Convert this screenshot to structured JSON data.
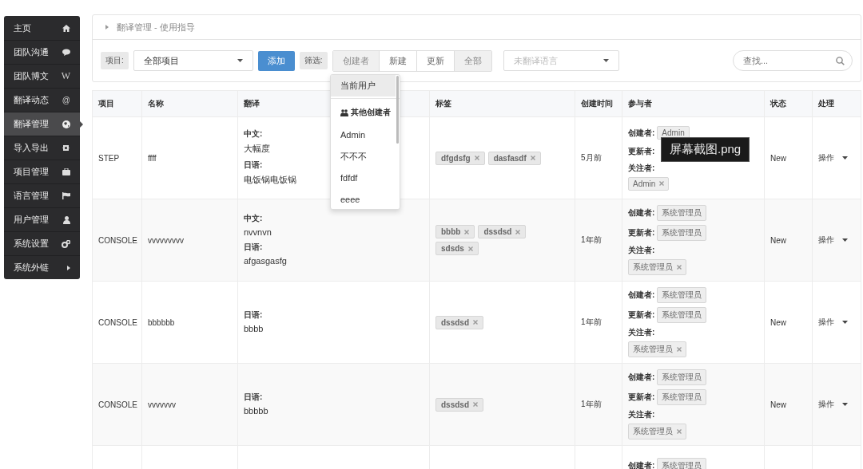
{
  "sidebar": {
    "items": [
      {
        "label": "主页",
        "selected": false
      },
      {
        "label": "团队沟通",
        "selected": false
      },
      {
        "label": "团队博文",
        "glyph": "W",
        "selected": false
      },
      {
        "label": "翻译动态",
        "glyph": "@",
        "selected": false
      },
      {
        "label": "翻译管理",
        "selected": true
      },
      {
        "label": "导入导出",
        "selected": false
      },
      {
        "label": "项目管理",
        "selected": false
      },
      {
        "label": "语言管理",
        "selected": false
      },
      {
        "label": "用户管理",
        "selected": false
      },
      {
        "label": "系统设置",
        "selected": false
      },
      {
        "label": "系统外链",
        "selected": false
      }
    ]
  },
  "breadcrumb": "翻译管理 - 使用指导",
  "toolbar": {
    "project_label": "项目:",
    "project_select": "全部项目",
    "add_button": "添加",
    "filter_label": "筛选:",
    "filters": [
      {
        "label": "创建者",
        "selected": true
      },
      {
        "label": "新建",
        "selected": false
      },
      {
        "label": "更新",
        "selected": false
      },
      {
        "label": "全部",
        "selected": true
      }
    ],
    "language_select": {
      "placeholder": "未翻译语言"
    },
    "search": {
      "placeholder": "查找..."
    }
  },
  "creator_menu": {
    "items": [
      {
        "kind": "option",
        "label": "当前用户",
        "selected": true
      },
      {
        "kind": "divider"
      },
      {
        "kind": "header",
        "label": "其他创建者"
      },
      {
        "kind": "option",
        "label": "Admin",
        "selected": false
      },
      {
        "kind": "option",
        "label": "不不不",
        "selected": false
      },
      {
        "kind": "option",
        "label": "fdfdf",
        "selected": false
      },
      {
        "kind": "option",
        "label": "eeee",
        "selected": false
      }
    ]
  },
  "table": {
    "columns": [
      "项目",
      "名称",
      "翻译",
      "标签",
      "创建时间",
      "参与者",
      "状态",
      "处理"
    ],
    "rows": [
      {
        "project": "STEP",
        "name": "ffff",
        "translations": [
          {
            "lang": "中文:",
            "text": "大幅度"
          },
          {
            "lang": "日语:",
            "text": "电饭锅电饭锅"
          }
        ],
        "tags": [
          "dfgdsfg",
          "dasfasdf"
        ],
        "created": "5月前",
        "participants": [
          {
            "kind": "inline",
            "label": "创建者:",
            "tags": [
              {
                "text": "Admin",
                "removable": false
              }
            ]
          },
          {
            "kind": "inline",
            "label": "更新者:"
          },
          {
            "kind": "stacked",
            "label": "关注者:",
            "tags": [
              {
                "text": "Admin",
                "removable": true
              }
            ]
          }
        ],
        "status": "New",
        "action": "操作"
      },
      {
        "project": "CONSOLE",
        "name": "vvvvvvvvv",
        "translations": [
          {
            "lang": "中文:",
            "text": "nvvnvn"
          },
          {
            "lang": "日语:",
            "text": "afgasgasfg"
          }
        ],
        "tags": [
          "bbbb",
          "dssdsd",
          "sdsds"
        ],
        "created": "1年前",
        "participants": [
          {
            "kind": "inline",
            "label": "创建者:",
            "tags": [
              {
                "text": "系统管理员",
                "removable": false
              }
            ]
          },
          {
            "kind": "inline",
            "label": "更新者:",
            "tags": [
              {
                "text": "系统管理员",
                "removable": false
              }
            ]
          },
          {
            "kind": "stacked",
            "label": "关注者:",
            "tags": [
              {
                "text": "系统管理员",
                "removable": true
              }
            ]
          }
        ],
        "status": "New",
        "action": "操作"
      },
      {
        "project": "CONSOLE",
        "name": "bbbbbb",
        "translations": [
          {
            "lang": "日语:",
            "text": "bbbb"
          }
        ],
        "tags": [
          "dssdsd"
        ],
        "created": "1年前",
        "participants": [
          {
            "kind": "inline",
            "label": "创建者:",
            "tags": [
              {
                "text": "系统管理员",
                "removable": false
              }
            ]
          },
          {
            "kind": "inline",
            "label": "更新者:",
            "tags": [
              {
                "text": "系统管理员",
                "removable": false
              }
            ]
          },
          {
            "kind": "stacked",
            "label": "关注者:",
            "tags": [
              {
                "text": "系统管理员",
                "removable": true
              }
            ]
          }
        ],
        "status": "New",
        "action": "操作"
      },
      {
        "project": "CONSOLE",
        "name": "vvvvvvv",
        "translations": [
          {
            "lang": "日语:",
            "text": "bbbbb"
          }
        ],
        "tags": [
          "dssdsd"
        ],
        "created": "1年前",
        "participants": [
          {
            "kind": "inline",
            "label": "创建者:",
            "tags": [
              {
                "text": "系统管理员",
                "removable": false
              }
            ]
          },
          {
            "kind": "inline",
            "label": "更新者:",
            "tags": [
              {
                "text": "系统管理员",
                "removable": false
              }
            ]
          },
          {
            "kind": "stacked",
            "label": "关注者:",
            "tags": [
              {
                "text": "系统管理员",
                "removable": true
              }
            ]
          }
        ],
        "status": "New",
        "action": "操作"
      },
      {
        "participants": [
          {
            "kind": "inline",
            "label": "创建者:",
            "tags": [
              {
                "text": "系统管理员",
                "removable": false
              }
            ]
          }
        ]
      }
    ]
  },
  "tooltip": "屏幕截图.png"
}
